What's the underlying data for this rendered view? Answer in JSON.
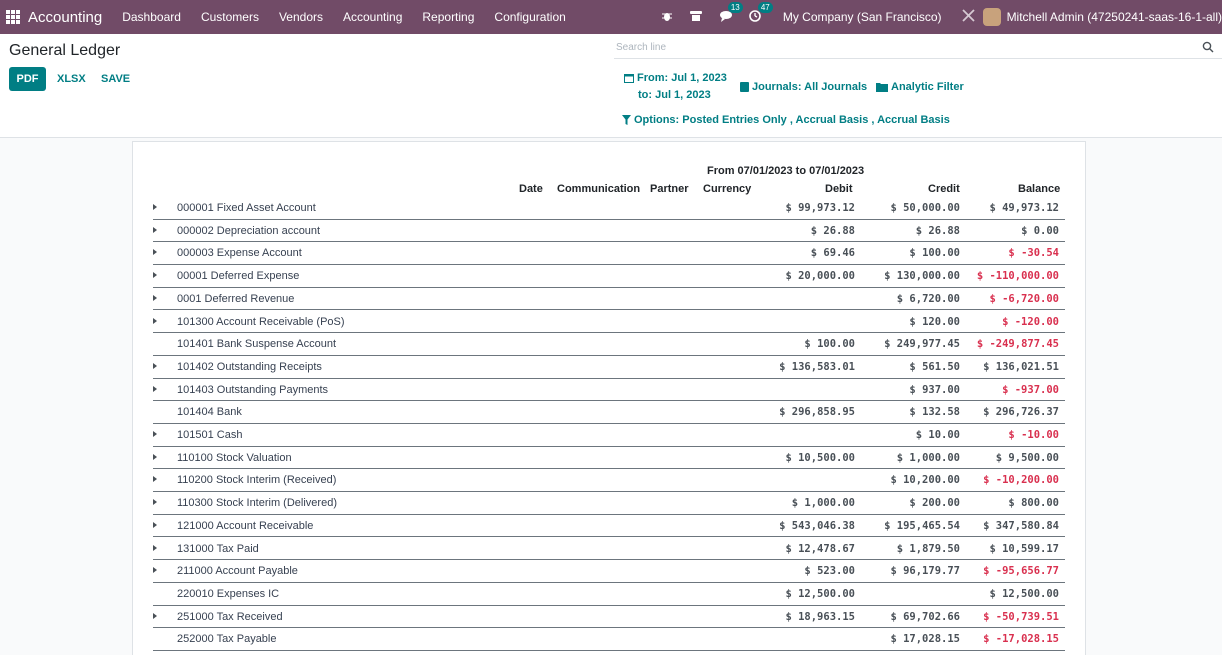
{
  "navbar": {
    "brand": "Accounting",
    "menu": [
      "Dashboard",
      "Customers",
      "Vendors",
      "Accounting",
      "Reporting",
      "Configuration"
    ],
    "messages_count": "13",
    "activities_count": "47",
    "company": "My Company (San Francisco)",
    "user": "Mitchell Admin (47250241-saas-16-1-all)",
    "color": "#714b67"
  },
  "control": {
    "title": "General Ledger",
    "pdf": "PDF",
    "xlsx": "XLSX",
    "save": "SAVE",
    "search_placeholder": "Search line",
    "date_from": "From: Jul 1, 2023",
    "date_to": "to: Jul 1, 2023",
    "journals": "Journals: All Journals",
    "analytic": "Analytic Filter",
    "options": "Options: Posted Entries Only , Accrual Basis , Accrual Basis",
    "accent": "#017e84"
  },
  "report": {
    "period": "From 07/01/2023 to 07/01/2023",
    "columns": {
      "date": "Date",
      "communication": "Communication",
      "partner": "Partner",
      "currency": "Currency",
      "debit": "Debit",
      "credit": "Credit",
      "balance": "Balance"
    },
    "rows": [
      {
        "account": "000001 Fixed Asset Account",
        "debit": "$ 99,973.12",
        "credit": "$ 50,000.00",
        "balance": "$ 49,973.12",
        "negative": false,
        "expandable": true
      },
      {
        "account": "000002 Depreciation account",
        "debit": "$ 26.88",
        "credit": "$ 26.88",
        "balance": "$ 0.00",
        "negative": false,
        "expandable": true
      },
      {
        "account": "000003 Expense Account",
        "debit": "$ 69.46",
        "credit": "$ 100.00",
        "balance": "$ -30.54",
        "negative": true,
        "expandable": true
      },
      {
        "account": "00001 Deferred Expense",
        "debit": "$ 20,000.00",
        "credit": "$ 130,000.00",
        "balance": "$ -110,000.00",
        "negative": true,
        "expandable": true
      },
      {
        "account": "0001 Deferred Revenue",
        "debit": "",
        "credit": "$ 6,720.00",
        "balance": "$ -6,720.00",
        "negative": true,
        "expandable": true
      },
      {
        "account": "101300 Account Receivable (PoS)",
        "debit": "",
        "credit": "$ 120.00",
        "balance": "$ -120.00",
        "negative": true,
        "expandable": true
      },
      {
        "account": "101401 Bank Suspense Account",
        "debit": "$ 100.00",
        "credit": "$ 249,977.45",
        "balance": "$ -249,877.45",
        "negative": true,
        "expandable": false
      },
      {
        "account": "101402 Outstanding Receipts",
        "debit": "$ 136,583.01",
        "credit": "$ 561.50",
        "balance": "$ 136,021.51",
        "negative": false,
        "expandable": true
      },
      {
        "account": "101403 Outstanding Payments",
        "debit": "",
        "credit": "$ 937.00",
        "balance": "$ -937.00",
        "negative": true,
        "expandable": true
      },
      {
        "account": "101404 Bank",
        "debit": "$ 296,858.95",
        "credit": "$ 132.58",
        "balance": "$ 296,726.37",
        "negative": false,
        "expandable": false
      },
      {
        "account": "101501 Cash",
        "debit": "",
        "credit": "$ 10.00",
        "balance": "$ -10.00",
        "negative": true,
        "expandable": true
      },
      {
        "account": "110100 Stock Valuation",
        "debit": "$ 10,500.00",
        "credit": "$ 1,000.00",
        "balance": "$ 9,500.00",
        "negative": false,
        "expandable": true
      },
      {
        "account": "110200 Stock Interim (Received)",
        "debit": "",
        "credit": "$ 10,200.00",
        "balance": "$ -10,200.00",
        "negative": true,
        "expandable": true
      },
      {
        "account": "110300 Stock Interim (Delivered)",
        "debit": "$ 1,000.00",
        "credit": "$ 200.00",
        "balance": "$ 800.00",
        "negative": false,
        "expandable": true
      },
      {
        "account": "121000 Account Receivable",
        "debit": "$ 543,046.38",
        "credit": "$ 195,465.54",
        "balance": "$ 347,580.84",
        "negative": false,
        "expandable": true
      },
      {
        "account": "131000 Tax Paid",
        "debit": "$ 12,478.67",
        "credit": "$ 1,879.50",
        "balance": "$ 10,599.17",
        "negative": false,
        "expandable": true
      },
      {
        "account": "211000 Account Payable",
        "debit": "$ 523.00",
        "credit": "$ 96,179.77",
        "balance": "$ -95,656.77",
        "negative": true,
        "expandable": true
      },
      {
        "account": "220010 Expenses IC",
        "debit": "$ 12,500.00",
        "credit": "",
        "balance": "$ 12,500.00",
        "negative": false,
        "expandable": false
      },
      {
        "account": "251000 Tax Received",
        "debit": "$ 18,963.15",
        "credit": "$ 69,702.66",
        "balance": "$ -50,739.51",
        "negative": true,
        "expandable": true
      },
      {
        "account": "252000 Tax Payable",
        "debit": "",
        "credit": "$ 17,028.15",
        "balance": "$ -17,028.15",
        "negative": true,
        "expandable": false
      }
    ]
  }
}
